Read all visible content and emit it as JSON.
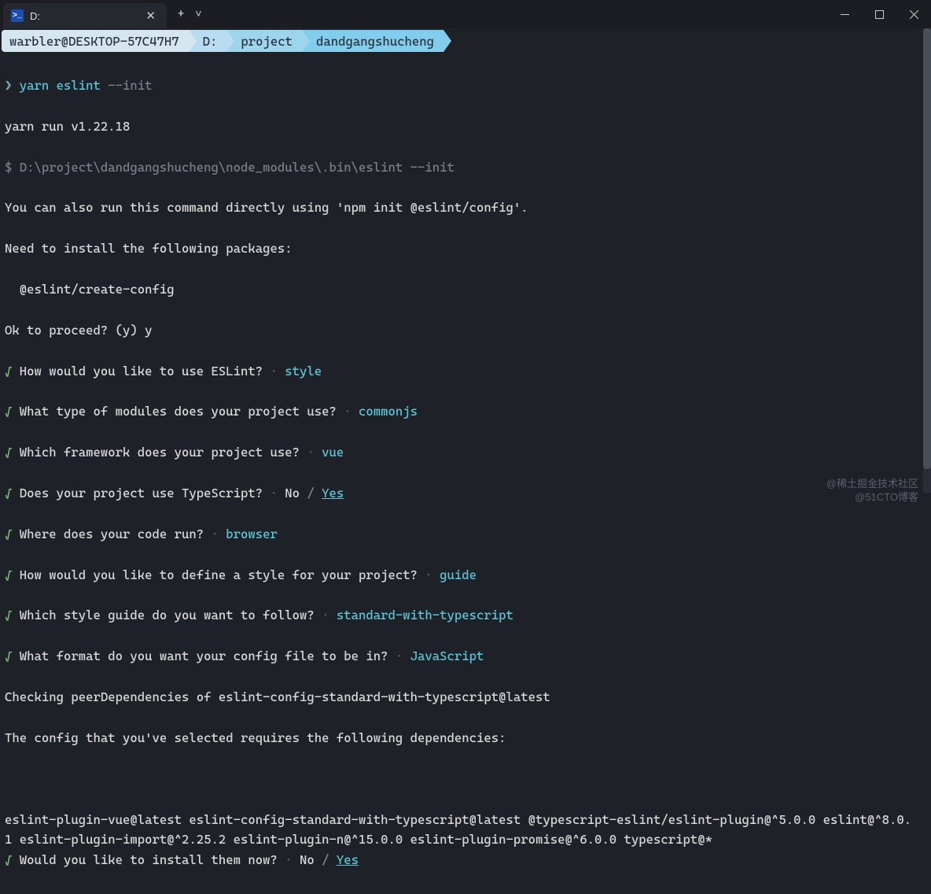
{
  "tab": {
    "title": "D:"
  },
  "breadcrumb": {
    "user": "warbler@DESKTOP-57C47H7",
    "drive": "D:",
    "proj": "project",
    "leaf": "dandgangshucheng"
  },
  "prompt": {
    "sym": "❯",
    "cmd": "yarn eslint ",
    "flag": "--init"
  },
  "lines": {
    "run": "yarn run v1.22.18",
    "dollar": "$ ",
    "binpath": "D:\\project\\dandgangshucheng\\node_modules\\.bin\\eslint --init",
    "caninfo": "You can also run this command directly using 'npm init @eslint/config'.",
    "need": "Need to install the following packages:",
    "pkg": "  @eslint/create-config",
    "ok": "Ok to proceed? (y) y"
  },
  "qa": [
    {
      "q": "How would you like to use ESLint?",
      "a": "style"
    },
    {
      "q": "What type of modules does your project use?",
      "a": "commonjs"
    },
    {
      "q": "Which framework does your project use?",
      "a": "vue"
    },
    {
      "q": "Does your project use TypeScript?",
      "no": "No",
      "a": "Yes",
      "yn": true
    },
    {
      "q": "Where does your code run?",
      "a": "browser"
    },
    {
      "q": "How would you like to define a style for your project?",
      "a": "guide"
    },
    {
      "q": "Which style guide do you want to follow?",
      "a": "standard-with-typescript"
    },
    {
      "q": "What format do you want your config file to be in?",
      "a": "JavaScript"
    }
  ],
  "checking": "Checking peerDependencies of eslint-config-standard-with-typescript@latest",
  "requires": "The config that you've selected requires the following dependencies:",
  "deps": "eslint-plugin-vue@latest eslint-config-standard-with-typescript@latest @typescript-eslint/eslint-plugin@^5.0.0 eslint@^8.0.1 eslint-plugin-import@^2.25.2 eslint-plugin-n@^15.0.0 eslint-plugin-promise@^6.0.0 typescript@*",
  "install": {
    "q": "Would you like to install them now?",
    "no": "No",
    "yes": "Yes"
  },
  "check": "√",
  "dot": "·",
  "slash": "/",
  "watermark": {
    "l1": "@稀土掘金技术社区",
    "l2": "@51CTO博客"
  }
}
